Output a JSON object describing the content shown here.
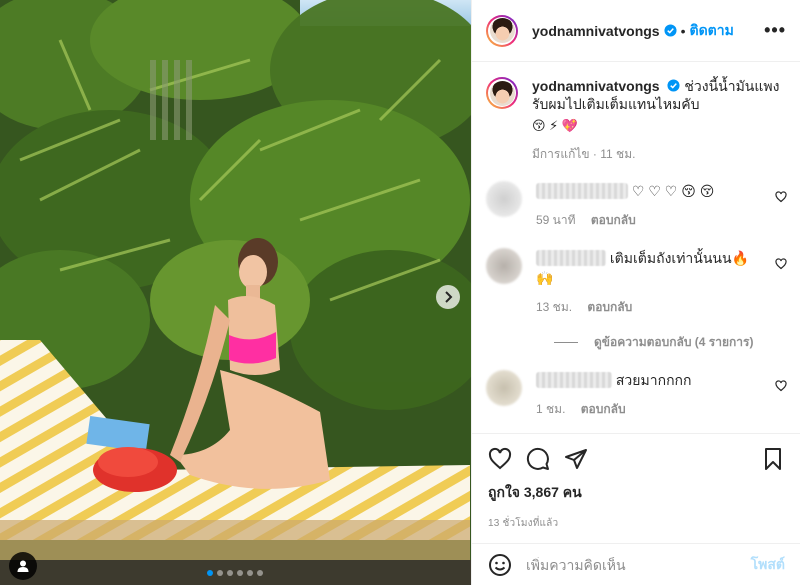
{
  "post": {
    "username": "yodnamnivatvongs",
    "follow_separator": "•",
    "follow_label": "ติดตาม",
    "more_label": "•••",
    "caption_text": "ช่วงนี้น้ำมันแพง รับผมไปเติมเต็มแทนไหมคับ",
    "caption_emojis": "😚 ⚡ 💖",
    "caption_meta": "มีการแก้ไข · 11 ชม."
  },
  "comments": [
    {
      "text": "♡ ♡ ♡ 😚 😚",
      "time": "59 นาที",
      "reply_label": "ตอบกลับ"
    },
    {
      "text": "เติมเต็มถังเท่านั้นนน🔥",
      "text_line2": "🙌",
      "time": "13 ชม.",
      "reply_label": "ตอบกลับ"
    },
    {
      "text": "สวยมากกกก",
      "time": "1 ชม.",
      "reply_label": "ตอบกลับ"
    }
  ],
  "view_replies_label": "ดูข้อความตอบกลับ (4 รายการ)",
  "likes_label": "ถูกใจ 3,867 คน",
  "posted_time": "13 ชั่วโมงที่แล้ว",
  "add_comment": {
    "placeholder": "เพิ่มความคิดเห็น",
    "post_label": "โพสต์"
  },
  "carousel": {
    "slides": 6,
    "active_index": 0
  },
  "icons": [
    "next-arrow-icon",
    "user-tag-icon",
    "verified-badge-icon",
    "heart-icon",
    "comment-icon",
    "share-icon",
    "bookmark-icon",
    "emoji-icon"
  ],
  "colors": {
    "accent": "#0095f6",
    "post_disabled": "#b2dffc",
    "muted": "#8e8e8e",
    "text": "#262626",
    "active_dot": "#0095f6"
  }
}
